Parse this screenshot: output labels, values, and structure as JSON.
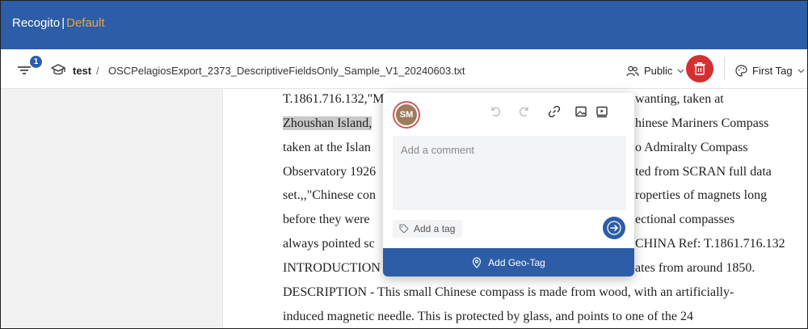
{
  "header": {
    "app_name": "Recogito",
    "separator": "|",
    "project_label": "Default"
  },
  "toolbar": {
    "filter_badge": "1",
    "breadcrumb_project": "test",
    "breadcrumb_separator": "/",
    "breadcrumb_file": "OSCPelagiosExport_2373_DescriptiveFieldsOnly_Sample_V1_20240603.txt",
    "visibility_label": "Public",
    "layer_label": "First Tag"
  },
  "document": {
    "lines": [
      {
        "pre": "T.1861.716.132,\"Ma",
        "hl": "",
        "post": ""
      },
      {
        "pre": "",
        "hl": "Zhoushan Island,",
        "post": ""
      },
      {
        "pre": "taken at the Islan",
        "hl": "",
        "post": ""
      },
      {
        "pre": "Observatory 1926",
        "hl": "",
        "post": ""
      },
      {
        "pre": "set.,,\"Chinese con",
        "hl": "",
        "post": ""
      },
      {
        "pre": "before they were",
        "hl": "",
        "post": ""
      },
      {
        "pre": "always pointed sc",
        "hl": "",
        "post": ""
      },
      {
        "pre": "INTRODUCTION",
        "hl": "",
        "post": ""
      },
      {
        "pre": "DESCRIPTION - This small Chinese compass is made from wood, with an artificially-",
        "hl": "",
        "post": ""
      },
      {
        "pre": "induced magnetic needle. This is protected by glass, and points to one of the 24",
        "hl": "",
        "post": ""
      }
    ],
    "right_fragments": [
      "wanting, taken at",
      "hinese Mariners Compass",
      "o Admiralty Compass",
      "ted from SCRAN full data",
      "roperties of magnets long",
      "ectional compasses",
      "CHINA  Ref: T.1861.716.132",
      "ates from around 1850."
    ]
  },
  "popup": {
    "avatar_initials": "SM",
    "comment_placeholder": "Add a comment",
    "tag_label": "Add a tag",
    "geotag_label": "Add Geo-Tag"
  },
  "colors": {
    "brand_blue": "#2d5da7",
    "accent_orange": "#f2a33a",
    "danger_red": "#d53031",
    "highlight_gray": "#c9c9c9"
  }
}
